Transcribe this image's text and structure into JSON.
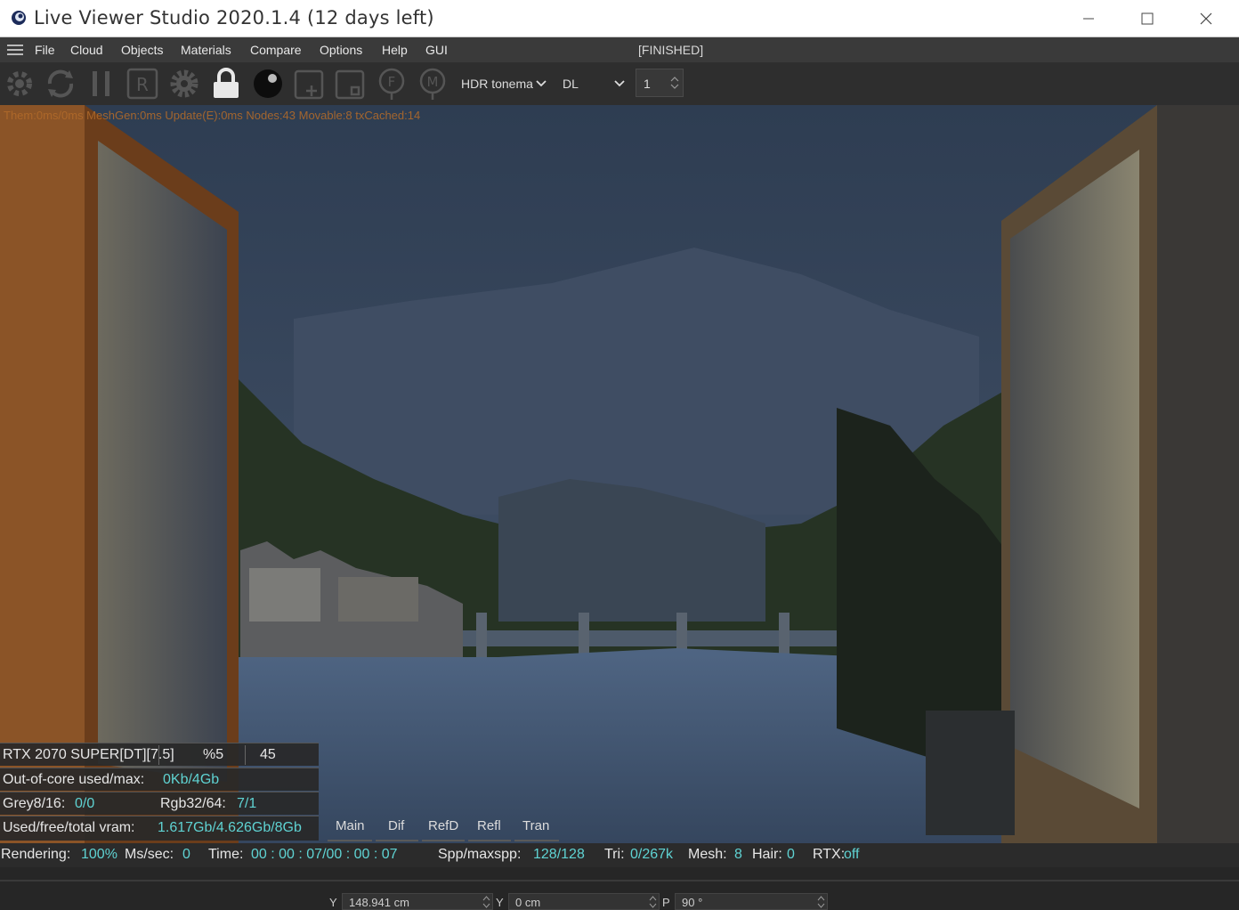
{
  "window": {
    "title": "Live Viewer Studio 2020.1.4 (12 days left)"
  },
  "menu": {
    "items": [
      "File",
      "Cloud",
      "Objects",
      "Materials",
      "Compare",
      "Options",
      "Help",
      "GUI"
    ],
    "status": "[FINISHED]"
  },
  "toolbar": {
    "tonemap_select": "HDR tonema",
    "mode_select": "DL",
    "pass_value": "1",
    "icons": [
      "settings-refresh-icon",
      "reload-icon",
      "pause-icon",
      "r-icon",
      "gear-icon",
      "lock-icon",
      "sphere-icon",
      "add-region-icon",
      "region-icon",
      "f-icon",
      "m-icon"
    ]
  },
  "viewport": {
    "stats_line": "Them:0ms/0ms  MeshGen:0ms  Update(E):0ms  Nodes:43  Movable:8  txCached:14"
  },
  "info_panel": {
    "gpu": "RTX 2070 SUPER[DT][7.5]",
    "gpu_percent": "%5",
    "gpu_value": "45",
    "outofcore_label": "Out-of-core used/max:",
    "outofcore_value": "0Kb/4Gb",
    "grey_label": "Grey8/16:",
    "grey_value": "0/0",
    "rgb_label": "Rgb32/64:",
    "rgb_value": "7/1",
    "vram_label": "Used/free/total vram:",
    "vram_value": "1.617Gb/4.626Gb/8Gb"
  },
  "render_tabs": [
    "Main",
    "Dif",
    "RefD",
    "Refl",
    "Tran"
  ],
  "statusbar": {
    "rendering_label": "Rendering:",
    "rendering_value": "100%",
    "mssec_label": "Ms/sec:",
    "mssec_value": "0",
    "time_label": "Time:",
    "time_value": "00 : 00 : 07/00 : 00 : 07",
    "spp_label": "Spp/maxspp:",
    "spp_value": "128/128",
    "tri_label": "Tri:",
    "tri_value": "0/267k",
    "mesh_label": "Mesh:",
    "mesh_value": "8",
    "hair_label": "Hair:",
    "hair_value": "0",
    "rtx_label": "RTX:",
    "rtx_value": "off"
  },
  "coords": {
    "y_label": "Y",
    "y_value": "148.941 cm",
    "y2_label": "Y",
    "y2_value": "0 cm",
    "p_label": "P",
    "p_value": "90 °"
  },
  "colors": {
    "accent": "#5fd3d3",
    "menu_bg": "#3a3a3a",
    "toolbar_bg": "#2e2e2e",
    "stats_text": "#b06a2a"
  }
}
